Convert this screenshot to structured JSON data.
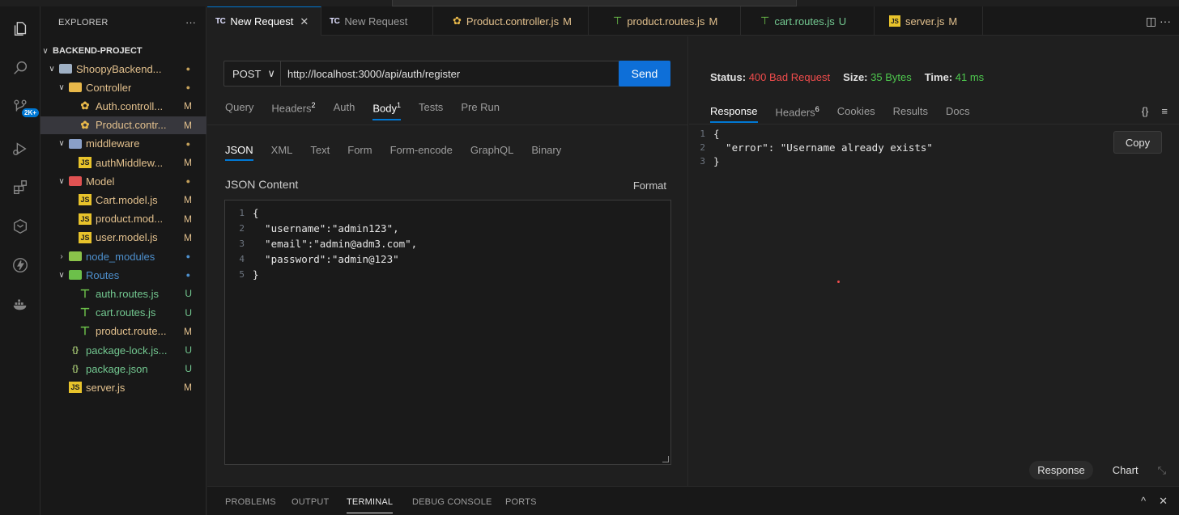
{
  "explorer": {
    "title": "EXPLORER",
    "more": "···",
    "root": "BACKEND-PROJECT",
    "tree": [
      {
        "name": "ShoopyBackend...",
        "kind": "folder-open",
        "depth": 1,
        "status": "●",
        "status_class": "c-dot-y",
        "name_class": "c-mod",
        "icon_color": "#9fb0c4"
      },
      {
        "name": "Controller",
        "kind": "folder-open",
        "depth": 2,
        "status": "●",
        "status_class": "c-dot-y",
        "name_class": "c-mod",
        "icon_color": "#e8b84a"
      },
      {
        "name": "Auth.controll...",
        "kind": "file",
        "depth": 3,
        "status": "M",
        "status_class": "c-mod",
        "name_class": "c-mod",
        "icon": "gear"
      },
      {
        "name": "Product.contr...",
        "kind": "file",
        "depth": 3,
        "status": "M",
        "status_class": "c-mod",
        "name_class": "c-mod",
        "icon": "gear",
        "selected": true
      },
      {
        "name": "middleware",
        "kind": "folder-open",
        "depth": 2,
        "status": "●",
        "status_class": "c-dot-y",
        "name_class": "c-mod",
        "icon_color": "#8aa0c8"
      },
      {
        "name": "authMiddlew...",
        "kind": "file",
        "depth": 3,
        "status": "M",
        "status_class": "c-mod",
        "name_class": "c-mod",
        "icon": "js"
      },
      {
        "name": "Model",
        "kind": "folder-open",
        "depth": 2,
        "status": "●",
        "status_class": "c-dot-y",
        "name_class": "c-mod",
        "icon_color": "#e05252"
      },
      {
        "name": "Cart.model.js",
        "kind": "file",
        "depth": 3,
        "status": "M",
        "status_class": "c-mod",
        "name_class": "c-mod",
        "icon": "js"
      },
      {
        "name": "product.mod...",
        "kind": "file",
        "depth": 3,
        "status": "M",
        "status_class": "c-mod",
        "name_class": "c-mod",
        "icon": "js"
      },
      {
        "name": "user.model.js",
        "kind": "file",
        "depth": 3,
        "status": "M",
        "status_class": "c-mod",
        "name_class": "c-mod",
        "icon": "js"
      },
      {
        "name": "node_modules",
        "kind": "folder-closed",
        "depth": 2,
        "status": "●",
        "status_class": "c-dot-b",
        "name_class": "c-dot-b",
        "icon_color": "#8bc34a"
      },
      {
        "name": "Routes",
        "kind": "folder-open",
        "depth": 2,
        "status": "●",
        "status_class": "c-dot-b",
        "name_class": "c-dot-b",
        "icon_color": "#6cc04a"
      },
      {
        "name": "auth.routes.js",
        "kind": "file",
        "depth": 3,
        "status": "U",
        "status_class": "c-unt",
        "name_class": "c-unt",
        "icon": "route"
      },
      {
        "name": "cart.routes.js",
        "kind": "file",
        "depth": 3,
        "status": "U",
        "status_class": "c-unt",
        "name_class": "c-unt",
        "icon": "route"
      },
      {
        "name": "product.route...",
        "kind": "file",
        "depth": 3,
        "status": "M",
        "status_class": "c-mod",
        "name_class": "c-mod",
        "icon": "route"
      },
      {
        "name": "package-lock.js...",
        "kind": "file",
        "depth": 2,
        "status": "U",
        "status_class": "c-unt",
        "name_class": "c-unt",
        "icon": "pkg"
      },
      {
        "name": "package.json",
        "kind": "file",
        "depth": 2,
        "status": "U",
        "status_class": "c-unt",
        "name_class": "c-unt",
        "icon": "pkg"
      },
      {
        "name": "server.js",
        "kind": "file",
        "depth": 2,
        "status": "M",
        "status_class": "c-mod",
        "name_class": "c-mod",
        "icon": "js"
      }
    ]
  },
  "activity": {
    "badge": "2K+",
    "icons": [
      "files-icon",
      "search-icon",
      "source-control-icon",
      "run-debug-icon",
      "extensions-icon",
      "thunder-client-icon",
      "thunder-bolt-icon",
      "docker-icon"
    ]
  },
  "tabs": [
    {
      "label": "New Request",
      "prefix": "TC",
      "active": true,
      "close": "✕"
    },
    {
      "label": "New Request",
      "prefix": "TC"
    },
    {
      "label": "Product.controller.js",
      "status": "M",
      "icon": "gear"
    },
    {
      "label": "product.routes.js",
      "status": "M",
      "icon": "route"
    },
    {
      "label": "cart.routes.js",
      "status": "U",
      "icon": "route"
    },
    {
      "label": "server.js",
      "status": "M",
      "icon": "js"
    }
  ],
  "tabbar_actions": "◫  ···",
  "request": {
    "method": "POST",
    "method_caret": "∨",
    "url": "http://localhost:3000/api/auth/register",
    "send": "Send",
    "subtabs": [
      {
        "label": "Query"
      },
      {
        "label": "Headers",
        "sup": "2"
      },
      {
        "label": "Auth"
      },
      {
        "label": "Body",
        "sup": "1",
        "active": true
      },
      {
        "label": "Tests"
      },
      {
        "label": "Pre Run"
      }
    ],
    "body_tabs": [
      {
        "label": "JSON",
        "active": true
      },
      {
        "label": "XML"
      },
      {
        "label": "Text"
      },
      {
        "label": "Form"
      },
      {
        "label": "Form-encode"
      },
      {
        "label": "GraphQL"
      },
      {
        "label": "Binary"
      }
    ],
    "json_label": "JSON Content",
    "format": "Format",
    "code": [
      "{",
      "  \"username\":\"admin123\",",
      "  \"email\":\"admin@adm3.com\",",
      "  \"password\":\"admin@123\"",
      "}"
    ]
  },
  "response": {
    "status_label": "Status:",
    "status_value": "400 Bad Request",
    "size_label": "Size:",
    "size_value": "35 Bytes",
    "time_label": "Time:",
    "time_value": "41 ms",
    "tabs": [
      {
        "label": "Response",
        "active": true
      },
      {
        "label": "Headers",
        "sup": "6"
      },
      {
        "label": "Cookies"
      },
      {
        "label": "Results"
      },
      {
        "label": "Docs"
      }
    ],
    "icons": [
      "{}",
      "≡"
    ],
    "copy": "Copy",
    "code": [
      "{",
      "  \"error\": \"Username already exists\"",
      "}"
    ],
    "footer_response": "Response",
    "footer_chart": "Chart"
  },
  "panel": {
    "tabs": [
      {
        "label": "PROBLEMS"
      },
      {
        "label": "OUTPUT"
      },
      {
        "label": "TERMINAL",
        "active": true
      },
      {
        "label": "DEBUG CONSOLE"
      },
      {
        "label": "PORTS"
      }
    ],
    "right": [
      "^",
      "✕"
    ]
  }
}
